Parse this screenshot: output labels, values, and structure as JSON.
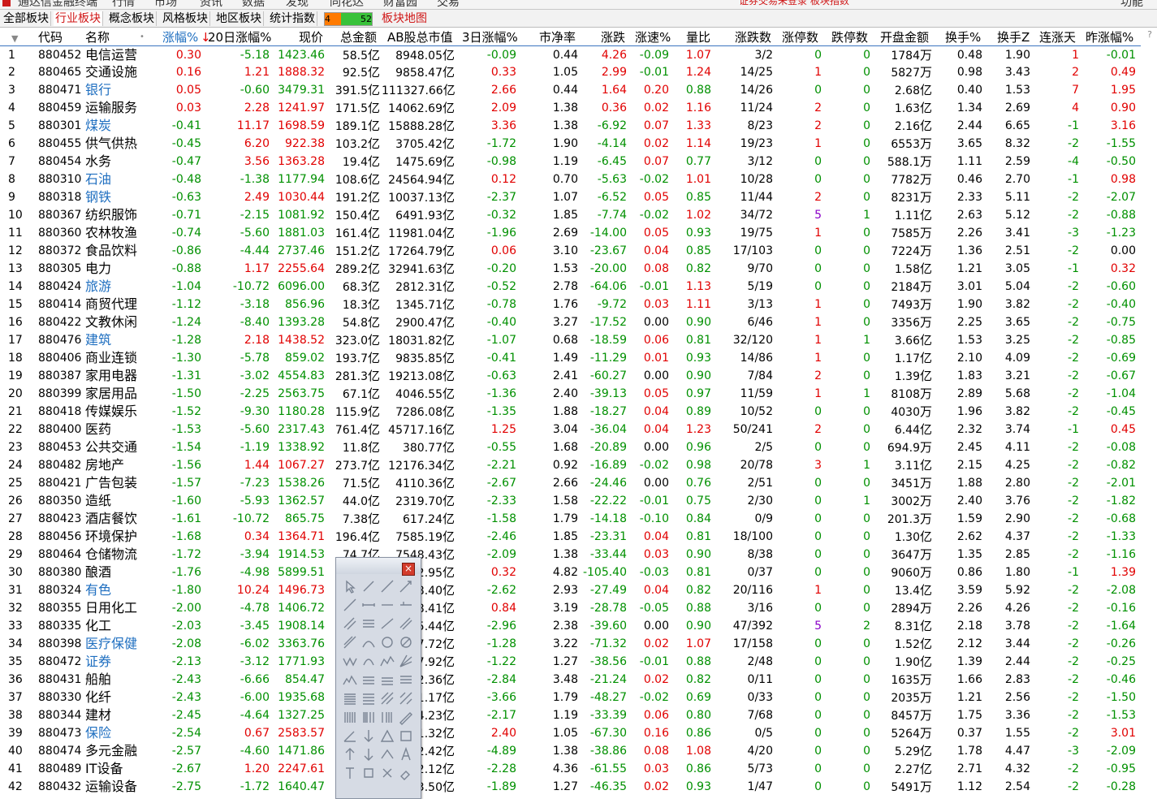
{
  "topbar": {
    "items": [
      "通达信金融终端",
      "行情",
      "市场",
      "资讯",
      "数据",
      "发现",
      "同花达",
      "财富园",
      "交易"
    ],
    "notice": "证券交易未登录   板块指数",
    "right_label": "功能"
  },
  "tabs": [
    "全部板块",
    "行业板块",
    "概念板块",
    "风格板块",
    "地区板块",
    "统计指数"
  ],
  "mini_chart": {
    "left_value": "4",
    "right_value": "52",
    "left_color": "#ff7a00",
    "right_color": "#39c23a"
  },
  "map_tab": "板块地图",
  "columns": [
    "代码",
    "名称",
    "•",
    "涨幅%",
    "20日涨幅%",
    "现价",
    "总金额",
    "AB股总市值",
    "3日涨幅%",
    "市净率",
    "涨跌",
    "涨速%",
    "量比",
    "涨跌数",
    "涨停数",
    "跌停数",
    "开盘金额",
    "换手%",
    "换手Z",
    "连涨天",
    "昨涨幅%"
  ],
  "sort_column": "涨幅%",
  "colors": {
    "up": "#e10000",
    "down": "#009000",
    "flat": "#000000",
    "link": "#1f6fc0",
    "limit_purple": "#8a00c8",
    "selection_line": "#3b74c0"
  },
  "rows": [
    [
      "1",
      "880452",
      "电信运营",
      "0.30",
      "-5.18",
      "1423.46",
      "58.5亿",
      "8948.05亿",
      "-0.09",
      "0.44",
      "4.26",
      "-0.09",
      "1.07",
      "3/2",
      "0",
      "0",
      "1784万",
      "0.48",
      "1.90",
      "1",
      "-0.01"
    ],
    [
      "2",
      "880465",
      "交通设施",
      "0.16",
      "1.21",
      "1888.32",
      "92.5亿",
      "9858.47亿",
      "0.33",
      "1.05",
      "2.99",
      "-0.01",
      "1.24",
      "14/25",
      "1",
      "0",
      "5827万",
      "0.98",
      "3.43",
      "2",
      "0.49"
    ],
    [
      "3",
      "880471",
      "银行",
      "0.05",
      "-0.60",
      "3479.31",
      "391.5亿",
      "111327.66亿",
      "2.66",
      "0.44",
      "1.64",
      "0.20",
      "0.88",
      "14/26",
      "0",
      "0",
      "2.68亿",
      "0.40",
      "1.53",
      "7",
      "1.95"
    ],
    [
      "4",
      "880459",
      "运输服务",
      "0.03",
      "2.28",
      "1241.97",
      "171.5亿",
      "14062.69亿",
      "2.09",
      "1.38",
      "0.36",
      "0.02",
      "1.16",
      "11/24",
      "2",
      "0",
      "1.63亿",
      "1.34",
      "2.69",
      "4",
      "0.90"
    ],
    [
      "5",
      "880301",
      "煤炭",
      "-0.41",
      "11.17",
      "1698.59",
      "189.1亿",
      "15888.28亿",
      "3.36",
      "1.38",
      "-6.92",
      "0.07",
      "1.33",
      "8/23",
      "2",
      "0",
      "2.16亿",
      "2.44",
      "6.65",
      "-1",
      "3.16"
    ],
    [
      "6",
      "880455",
      "供气供热",
      "-0.45",
      "6.20",
      "922.38",
      "103.2亿",
      "3705.42亿",
      "-1.72",
      "1.90",
      "-4.14",
      "0.02",
      "1.14",
      "19/23",
      "1",
      "0",
      "6553万",
      "3.65",
      "8.32",
      "-2",
      "-1.55"
    ],
    [
      "7",
      "880454",
      "水务",
      "-0.47",
      "3.56",
      "1363.28",
      "19.4亿",
      "1475.69亿",
      "-0.98",
      "1.19",
      "-6.45",
      "0.07",
      "0.77",
      "3/12",
      "0",
      "0",
      "588.1万",
      "1.11",
      "2.59",
      "-4",
      "-0.50"
    ],
    [
      "8",
      "880310",
      "石油",
      "-0.48",
      "-1.38",
      "1177.94",
      "108.6亿",
      "24564.94亿",
      "0.12",
      "0.70",
      "-5.63",
      "-0.02",
      "1.01",
      "10/28",
      "0",
      "0",
      "7782万",
      "0.46",
      "2.70",
      "-1",
      "0.98"
    ],
    [
      "9",
      "880318",
      "钢铁",
      "-0.63",
      "2.49",
      "1030.44",
      "191.2亿",
      "10037.13亿",
      "-2.37",
      "1.07",
      "-6.52",
      "0.05",
      "0.85",
      "11/44",
      "2",
      "0",
      "8231万",
      "2.33",
      "5.11",
      "-2",
      "-2.07"
    ],
    [
      "10",
      "880367",
      "纺织服饰",
      "-0.71",
      "-2.15",
      "1081.92",
      "150.4亿",
      "6491.93亿",
      "-0.32",
      "1.85",
      "-7.74",
      "-0.02",
      "1.02",
      "34/72",
      "5",
      "1",
      "1.11亿",
      "2.63",
      "5.12",
      "-2",
      "-0.88"
    ],
    [
      "11",
      "880360",
      "农林牧渔",
      "-0.74",
      "-5.60",
      "1881.03",
      "161.4亿",
      "11981.04亿",
      "-1.96",
      "2.69",
      "-14.00",
      "0.05",
      "0.93",
      "19/75",
      "1",
      "0",
      "7585万",
      "2.26",
      "3.41",
      "-3",
      "-1.23"
    ],
    [
      "12",
      "880372",
      "食品饮料",
      "-0.86",
      "-4.44",
      "2737.46",
      "151.2亿",
      "17264.79亿",
      "0.06",
      "3.10",
      "-23.67",
      "0.04",
      "0.85",
      "17/103",
      "0",
      "0",
      "7224万",
      "1.36",
      "2.51",
      "-2",
      "0.00"
    ],
    [
      "13",
      "880305",
      "电力",
      "-0.88",
      "1.17",
      "2255.64",
      "289.2亿",
      "32941.63亿",
      "-0.20",
      "1.53",
      "-20.00",
      "0.08",
      "0.82",
      "9/70",
      "0",
      "0",
      "1.58亿",
      "1.21",
      "3.05",
      "-1",
      "0.32"
    ],
    [
      "14",
      "880424",
      "旅游",
      "-1.04",
      "-10.72",
      "6096.00",
      "68.3亿",
      "2812.31亿",
      "-0.52",
      "2.78",
      "-64.06",
      "-0.01",
      "1.13",
      "5/19",
      "0",
      "0",
      "2184万",
      "3.01",
      "5.04",
      "-2",
      "-0.60"
    ],
    [
      "15",
      "880414",
      "商贸代理",
      "-1.12",
      "-3.18",
      "856.96",
      "18.3亿",
      "1345.71亿",
      "-0.78",
      "1.76",
      "-9.72",
      "0.03",
      "1.11",
      "3/13",
      "1",
      "0",
      "7493万",
      "1.90",
      "3.82",
      "-2",
      "-0.40"
    ],
    [
      "16",
      "880422",
      "文教休闲",
      "-1.24",
      "-8.40",
      "1393.28",
      "54.8亿",
      "2900.47亿",
      "-0.40",
      "3.27",
      "-17.52",
      "0.00",
      "0.90",
      "6/46",
      "1",
      "0",
      "3356万",
      "2.25",
      "3.65",
      "-2",
      "-0.75"
    ],
    [
      "17",
      "880476",
      "建筑",
      "-1.28",
      "2.18",
      "1438.52",
      "323.0亿",
      "18031.82亿",
      "-1.07",
      "0.68",
      "-18.59",
      "0.06",
      "0.81",
      "32/120",
      "1",
      "1",
      "3.66亿",
      "1.53",
      "3.25",
      "-2",
      "-0.85"
    ],
    [
      "18",
      "880406",
      "商业连锁",
      "-1.30",
      "-5.78",
      "859.02",
      "193.7亿",
      "9835.85亿",
      "-0.41",
      "1.49",
      "-11.29",
      "0.01",
      "0.93",
      "14/86",
      "1",
      "0",
      "1.17亿",
      "2.10",
      "4.09",
      "-2",
      "-0.69"
    ],
    [
      "19",
      "880387",
      "家用电器",
      "-1.31",
      "-3.02",
      "4554.83",
      "281.3亿",
      "19213.08亿",
      "-0.63",
      "2.41",
      "-60.27",
      "0.00",
      "0.90",
      "7/84",
      "2",
      "0",
      "1.39亿",
      "1.83",
      "3.21",
      "-2",
      "-0.67"
    ],
    [
      "20",
      "880399",
      "家居用品",
      "-1.50",
      "-2.25",
      "2563.75",
      "67.1亿",
      "4046.55亿",
      "-1.36",
      "2.40",
      "-39.13",
      "0.05",
      "0.97",
      "11/59",
      "1",
      "1",
      "8108万",
      "2.89",
      "5.68",
      "-2",
      "-1.04"
    ],
    [
      "21",
      "880418",
      "传媒娱乐",
      "-1.52",
      "-9.30",
      "1180.28",
      "115.9亿",
      "7286.08亿",
      "-1.35",
      "1.88",
      "-18.27",
      "0.04",
      "0.89",
      "10/52",
      "0",
      "0",
      "4030万",
      "1.96",
      "3.82",
      "-2",
      "-0.45"
    ],
    [
      "22",
      "880400",
      "医药",
      "-1.53",
      "-5.60",
      "2317.43",
      "761.4亿",
      "45717.16亿",
      "1.25",
      "3.04",
      "-36.04",
      "0.04",
      "1.23",
      "50/241",
      "2",
      "0",
      "6.44亿",
      "2.32",
      "3.74",
      "-1",
      "0.45"
    ],
    [
      "23",
      "880453",
      "公共交通",
      "-1.54",
      "-1.19",
      "1338.92",
      "11.8亿",
      "380.77亿",
      "-0.55",
      "1.68",
      "-20.89",
      "0.00",
      "0.96",
      "2/5",
      "0",
      "0",
      "694.9万",
      "2.45",
      "4.11",
      "-2",
      "-0.08"
    ],
    [
      "24",
      "880482",
      "房地产",
      "-1.56",
      "1.44",
      "1067.27",
      "273.7亿",
      "12176.34亿",
      "-2.21",
      "0.92",
      "-16.89",
      "-0.02",
      "0.98",
      "20/78",
      "3",
      "1",
      "3.11亿",
      "2.15",
      "4.25",
      "-2",
      "-0.82"
    ],
    [
      "25",
      "880421",
      "广告包装",
      "-1.57",
      "-7.23",
      "1538.26",
      "71.5亿",
      "4110.36亿",
      "-2.67",
      "2.66",
      "-24.46",
      "0.00",
      "0.76",
      "2/51",
      "0",
      "0",
      "3451万",
      "1.88",
      "2.80",
      "-2",
      "-2.01"
    ],
    [
      "26",
      "880350",
      "造纸",
      "-1.60",
      "-5.93",
      "1362.57",
      "44.0亿",
      "2319.70亿",
      "-2.33",
      "1.58",
      "-22.22",
      "-0.01",
      "0.75",
      "2/30",
      "0",
      "1",
      "3002万",
      "2.40",
      "3.76",
      "-2",
      "-1.82"
    ],
    [
      "27",
      "880423",
      "酒店餐饮",
      "-1.61",
      "-10.72",
      "865.75",
      "7.38亿",
      "617.24亿",
      "-1.58",
      "1.79",
      "-14.18",
      "-0.10",
      "0.84",
      "0/9",
      "0",
      "0",
      "201.3万",
      "1.59",
      "2.90",
      "-2",
      "-0.68"
    ],
    [
      "28",
      "880456",
      "环境保护",
      "-1.68",
      "0.34",
      "1364.71",
      "196.4亿",
      "7585.19亿",
      "-2.46",
      "1.85",
      "-23.31",
      "0.04",
      "0.81",
      "18/100",
      "0",
      "0",
      "1.30亿",
      "2.62",
      "4.37",
      "-2",
      "-1.33"
    ],
    [
      "29",
      "880464",
      "仓储物流",
      "-1.72",
      "-3.94",
      "1914.53",
      "74.7亿",
      "7548.43亿",
      "-2.09",
      "1.38",
      "-33.44",
      "0.03",
      "0.90",
      "8/38",
      "0",
      "0",
      "3647万",
      "1.35",
      "2.85",
      "-2",
      "-1.16"
    ],
    [
      "30",
      "880380",
      "酿酒",
      "-1.76",
      "-4.98",
      "5899.51",
      "148.7亿",
      "42232.95亿",
      "0.32",
      "4.82",
      "-105.40",
      "-0.03",
      "0.81",
      "0/37",
      "0",
      "0",
      "9060万",
      "0.86",
      "1.80",
      "-1",
      "1.39"
    ],
    [
      "31",
      "880324",
      "有色",
      "-1.80",
      "10.24",
      "1496.73",
      "455.1亿",
      "22708.40亿",
      "-2.62",
      "2.93",
      "-27.49",
      "0.04",
      "0.82",
      "20/116",
      "1",
      "0",
      "13.4亿",
      "3.59",
      "5.92",
      "-2",
      "-2.08"
    ],
    [
      "32",
      "880355",
      "日用化工",
      "-2.00",
      "-4.78",
      "1406.72",
      "21.0亿",
      "1488.41亿",
      "0.84",
      "3.19",
      "-28.78",
      "-0.05",
      "0.88",
      "3/16",
      "0",
      "0",
      "2894万",
      "2.26",
      "4.26",
      "-2",
      "-0.16"
    ],
    [
      "33",
      "880335",
      "化工",
      "-2.03",
      "-3.45",
      "1908.14",
      "609.2亿",
      "29785.44亿",
      "-2.96",
      "2.38",
      "-39.60",
      "0.00",
      "0.90",
      "47/392",
      "5",
      "2",
      "8.31亿",
      "2.18",
      "3.78",
      "-2",
      "-1.64"
    ],
    [
      "34",
      "880398",
      "医疗保健",
      "-2.08",
      "-6.02",
      "3363.76",
      "138.7亿",
      "8917.72亿",
      "-1.28",
      "3.22",
      "-71.32",
      "0.02",
      "1.07",
      "17/158",
      "0",
      "0",
      "1.52亿",
      "2.12",
      "3.44",
      "-2",
      "-0.26"
    ],
    [
      "35",
      "880472",
      "证券",
      "-2.13",
      "-3.12",
      "1771.93",
      "234.7亿",
      "26897.92亿",
      "-1.22",
      "1.27",
      "-38.56",
      "-0.01",
      "0.88",
      "2/48",
      "0",
      "0",
      "1.90亿",
      "1.39",
      "2.44",
      "-2",
      "-0.25"
    ],
    [
      "36",
      "880431",
      "船舶",
      "-2.43",
      "-6.66",
      "854.47",
      "21.6亿",
      "1902.36亿",
      "-2.84",
      "3.48",
      "-21.24",
      "0.02",
      "0.82",
      "0/11",
      "0",
      "0",
      "1635万",
      "1.66",
      "2.83",
      "-2",
      "-0.46"
    ],
    [
      "37",
      "880330",
      "化纤",
      "-2.43",
      "-6.00",
      "1935.68",
      "48.9亿",
      "3351.17亿",
      "-3.66",
      "1.79",
      "-48.27",
      "-0.02",
      "0.69",
      "0/33",
      "0",
      "0",
      "2035万",
      "1.21",
      "2.56",
      "-2",
      "-1.50"
    ],
    [
      "38",
      "880344",
      "建材",
      "-2.45",
      "-4.64",
      "1327.25",
      "118.0亿",
      "8634.23亿",
      "-2.17",
      "1.19",
      "-33.39",
      "0.06",
      "0.80",
      "7/68",
      "0",
      "0",
      "8457万",
      "1.75",
      "3.36",
      "-2",
      "-1.53"
    ],
    [
      "39",
      "880473",
      "保险",
      "-2.54",
      "0.67",
      "2583.57",
      "37.0亿",
      "24651.32亿",
      "2.40",
      "1.05",
      "-67.30",
      "0.16",
      "0.86",
      "0/5",
      "0",
      "0",
      "5264万",
      "0.37",
      "1.55",
      "-2",
      "3.01"
    ],
    [
      "40",
      "880474",
      "多元金融",
      "-2.57",
      "-4.60",
      "1471.86",
      "88.4亿",
      "5862.42亿",
      "-4.89",
      "1.38",
      "-38.86",
      "0.08",
      "1.08",
      "4/20",
      "0",
      "0",
      "5.29亿",
      "1.78",
      "4.47",
      "-3",
      "-2.09"
    ],
    [
      "41",
      "880489",
      "IT设备",
      "-2.67",
      "1.20",
      "2247.61",
      "196.2亿",
      "8032.12亿",
      "-2.28",
      "4.36",
      "-61.55",
      "0.03",
      "0.86",
      "5/73",
      "0",
      "0",
      "2.27亿",
      "2.71",
      "4.32",
      "-2",
      "-0.95"
    ],
    [
      "42",
      "880432",
      "运输设备",
      "-2.75",
      "-1.72",
      "1640.47",
      "63.2亿",
      "5823.50亿",
      "-1.89",
      "1.27",
      "-46.35",
      "0.02",
      "0.93",
      "1/47",
      "0",
      "0",
      "5491万",
      "1.12",
      "2.54",
      "-2",
      "-0.28"
    ]
  ],
  "link_names": [
    "银行",
    "煤炭",
    "石油",
    "钢铁",
    "旅游",
    "建筑",
    "有色",
    "医疗保健",
    "证券",
    "保险"
  ],
  "toolbox": {
    "title": "",
    "close_label": "×",
    "tools": [
      "pointer-icon",
      "line-icon",
      "ray-icon",
      "arrow-line-icon",
      "trend-line-icon",
      "segment-icon",
      "horizontal-line-icon",
      "price-line-icon",
      "parallel-icon",
      "price-label-icon",
      "line-up-icon",
      "channel-icon",
      "diagonal-icon",
      "arc-icon",
      "circle-icon",
      "no-entry-icon",
      "wave-icon",
      "half-circle-icon",
      "zigzag-icon",
      "fan-icon",
      "mountain-icon",
      "golden-ratio-icon",
      "gann-icon",
      "speed-line-icon",
      "fib-fan-icon",
      "fib-retrace-icon",
      "fib-grid-icon",
      "diagonal-grid-icon",
      "vertical-bars-icon",
      "cycle-icon",
      "cycle-alt-icon",
      "pen-icon",
      "angle-icon",
      "down-arrow-icon",
      "triangle-icon",
      "rectangle-icon",
      "up-arrow-icon",
      "down-arrow2-icon",
      "up-mark-icon",
      "text-icon",
      "text-alt-icon",
      "square-icon",
      "delete-icon",
      "eraser-icon"
    ]
  }
}
